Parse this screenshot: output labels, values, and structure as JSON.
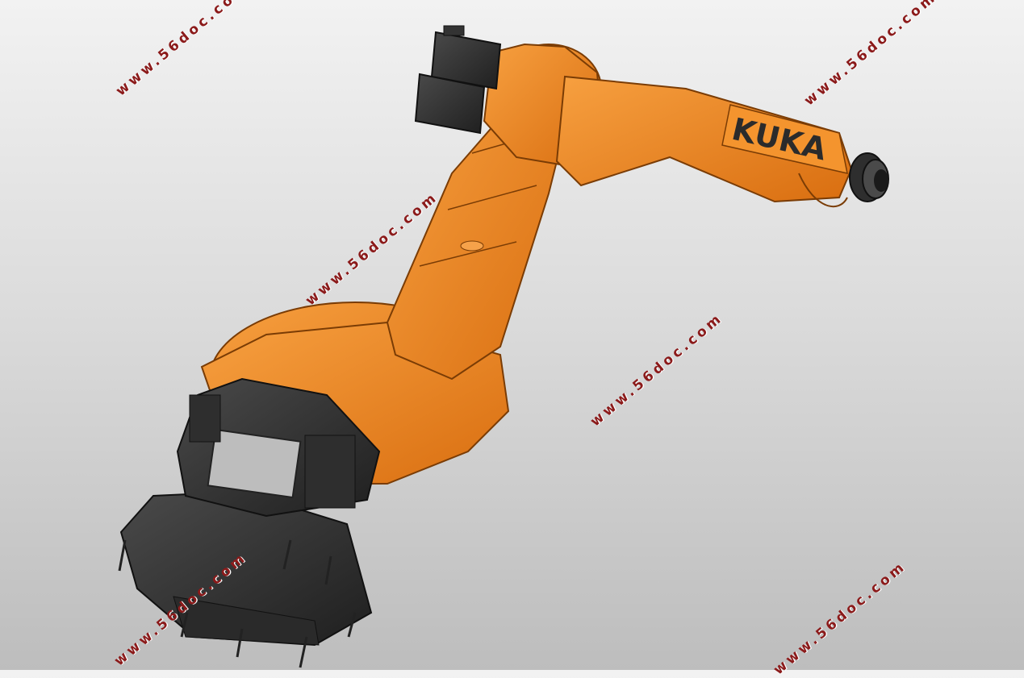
{
  "model": {
    "brand_label": "KUKA",
    "body_color": "#f08a1e",
    "shadow_color": "#c45e0a",
    "dark_color": "#3a3a3a"
  },
  "watermarks": [
    {
      "text": "www.56doc.com"
    },
    {
      "text": "www.56doc.com"
    },
    {
      "text": "www.56doc.com"
    },
    {
      "text": "www.56doc.com"
    },
    {
      "text": "www.56doc.com"
    },
    {
      "text": "www.56doc.com"
    }
  ]
}
